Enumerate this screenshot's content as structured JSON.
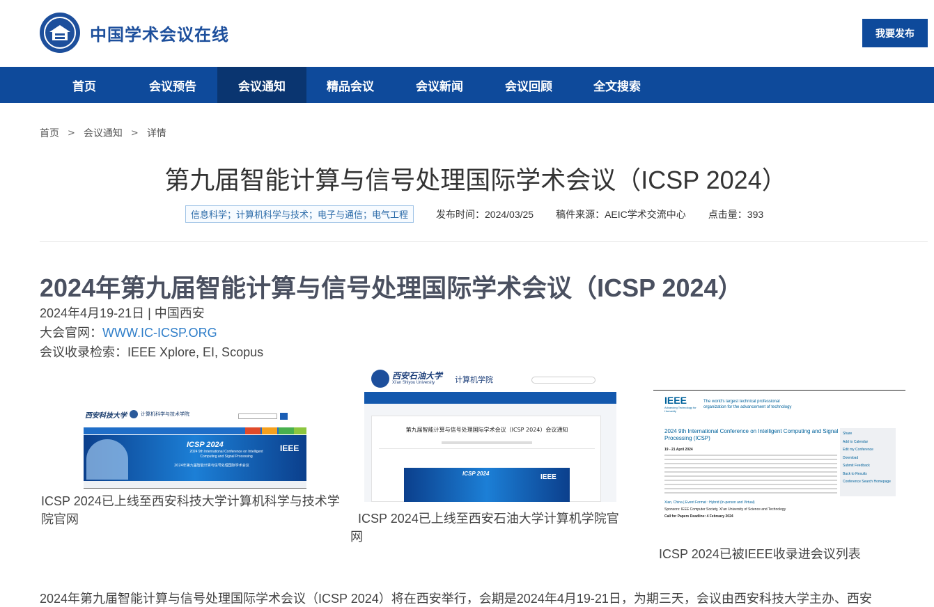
{
  "header": {
    "site_name": "中国学术会议在线",
    "publish_label": "我要发布"
  },
  "nav": {
    "items": [
      {
        "label": "首页"
      },
      {
        "label": "会议预告"
      },
      {
        "label": "会议通知"
      },
      {
        "label": "精品会议"
      },
      {
        "label": "会议新闻"
      },
      {
        "label": "会议回顾"
      },
      {
        "label": "全文搜索"
      }
    ],
    "active": "会议通知"
  },
  "breadcrumb": {
    "items": [
      "首页",
      "会议通知",
      "详情"
    ],
    "separator": ">"
  },
  "page": {
    "title": "第九届智能计算与信号处理国际学术会议（ICSP 2024）",
    "tags": "信息科学；计算机科学与技术；电子与通信；电气工程",
    "publish_time_label": "发布时间：",
    "publish_time": "2024/03/25",
    "source_label": "稿件来源：",
    "source": "AEIC学术交流中心",
    "views_label": "点击量：",
    "views": "393"
  },
  "article": {
    "title": "2024年第九届智能计算与信号处理国际学术会议（ICSP 2024）",
    "date_location": "2024年4月19-21日 | 中国西安",
    "website_label": "大会官网：",
    "website": "WWW.IC-ICSP.ORG",
    "index_label": "会议收录检索：",
    "index": "IEEE Xplore, EI, Scopus",
    "images": [
      {
        "caption": "ICSP 2024已上线至西安科技大学计算机科学与技术学院官网",
        "school": "西安科技大学",
        "college": "计算机科学与技术学院",
        "banner_title": "ICSP 2024",
        "banner_text": "2024 9th International Conference on Intelligent Computing and Signal Processing",
        "banner_cn": "2024年第九届智能计算与信号处理国际学术会议",
        "ieee": "IEEE"
      },
      {
        "caption": "ICSP 2024已上线至西安石油大学计算机学院官网",
        "school": "西安石油大学",
        "school_en": "Xi'an Shiyou University",
        "college": "计算机学院",
        "notice_title": "第九届智能计算与信号处理国际学术会议（ICSP 2024）会议通知",
        "banner_title": "ICSP 2024",
        "ieee": "IEEE"
      },
      {
        "caption": "ICSP 2024已被IEEE收录进会议列表",
        "ieee": "IEEE",
        "ieee_tagline": "Advancing Technology for Humanity",
        "ieee_slogan": "The world's largest technical professional organization for the advancement of technology",
        "conf_title": "2024 9th International Conference on Intelligent Computing and Signal Processing (ICSP)",
        "conf_date": "19 - 21 April 2024",
        "side_links": [
          "Share",
          "Add to Calendar",
          "Edit my Conference",
          "Download",
          "Submit Feedback",
          "Back to Results",
          "Conference Search Homepage"
        ],
        "location": "Xian, China | Event Format : Hybrid (In-person and Virtual)",
        "sponsors": "Sponsors: IEEE Computer Society, Xi'an University of Science and Technology",
        "deadline": "Call for Papers Deadline: 4 February 2024"
      }
    ],
    "paragraph": "2024年第九届智能计算与信号处理国际学术会议（ICSP 2024）将在西安举行，会期是2024年4月19-21日，为期三天，会议由西安科技大学主办、西安"
  },
  "colors": {
    "brand_blue": "#0e4a9b",
    "nav_active": "#0a3570",
    "link_blue": "#2f7ec9",
    "article_title": "#4a5060"
  }
}
